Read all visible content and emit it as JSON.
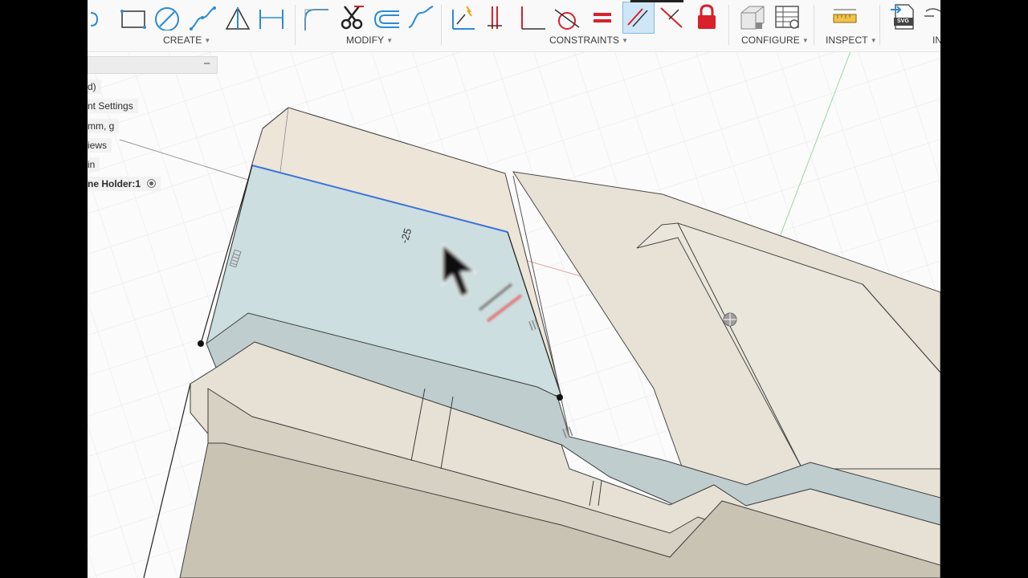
{
  "toolbar": {
    "groups": [
      {
        "label": "CREATE"
      },
      {
        "label": "MODIFY"
      },
      {
        "label": "CONSTRAINTS"
      },
      {
        "label": "CONFIGURE"
      },
      {
        "label": "INSPECT"
      },
      {
        "label": "IN"
      }
    ],
    "svg_badge": "SVG"
  },
  "browser": {
    "items": [
      {
        "label": "d)"
      },
      {
        "label": "nt Settings"
      },
      {
        "label": "mm, g"
      },
      {
        "label": "iews"
      },
      {
        "label": "in"
      },
      {
        "label": "ne Holder:1"
      }
    ]
  },
  "viewport": {
    "dimension_value": "-25"
  },
  "colors": {
    "selected_face": "#c9dde0",
    "body_face": "#e7e2d7",
    "sketch_line": "#3d73d9",
    "y_axis": "#8fd39a",
    "x_axis": "#e39a9a",
    "constraint_red": "#d8212b"
  }
}
